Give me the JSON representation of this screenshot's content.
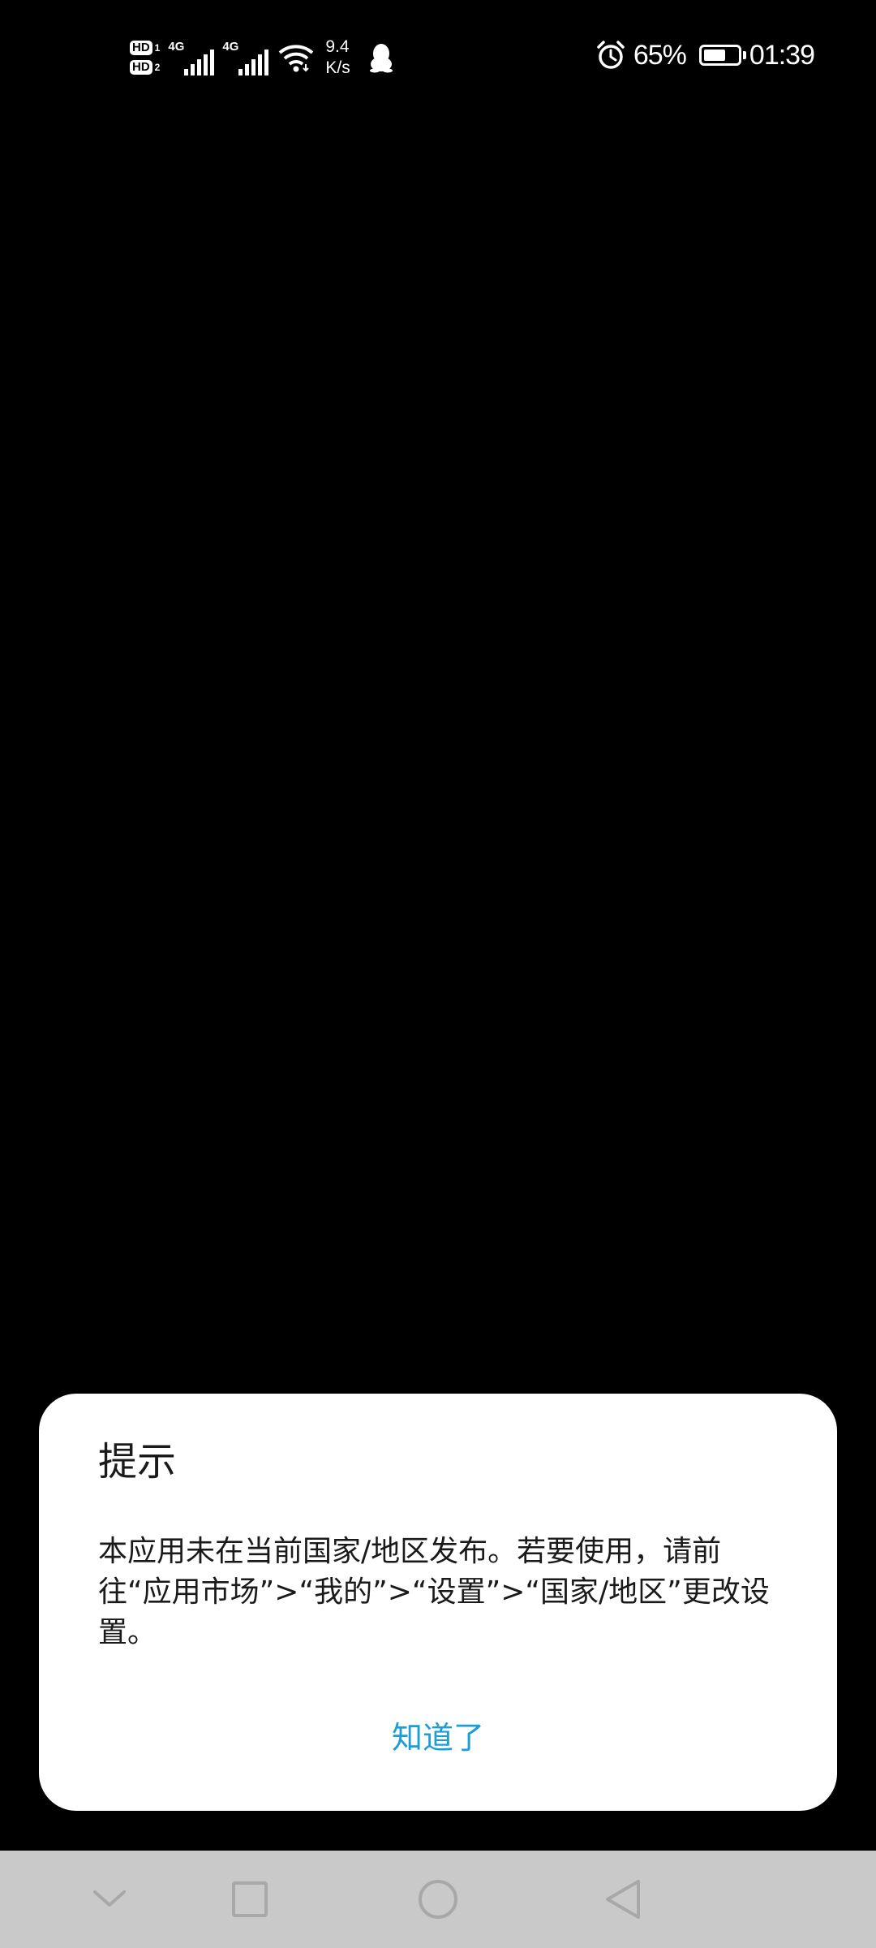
{
  "status_bar": {
    "sim1_label": "HD",
    "sim1_num": "1",
    "sim2_label": "HD",
    "sim2_num": "2",
    "network1": "4G",
    "network2": "4G",
    "speed_value": "9.4",
    "speed_unit": "K/s",
    "battery_percent": "65%",
    "battery_level": 0.65,
    "time": "01:39",
    "icons": [
      "wifi-icon",
      "qq-icon",
      "alarm-icon",
      "battery-icon"
    ]
  },
  "dialog": {
    "title": "提示",
    "message": "本应用未在当前国家/地区发布。若要使用，请前往“应用市场”>“我的”>“设置”>“国家/地区”更改设置。",
    "confirm_label": "知道了",
    "accent_color": "#1a9ed8"
  },
  "nav_bar": {
    "icons": [
      "chevron-down-icon",
      "recents-square-icon",
      "home-circle-icon",
      "back-triangle-icon"
    ]
  }
}
